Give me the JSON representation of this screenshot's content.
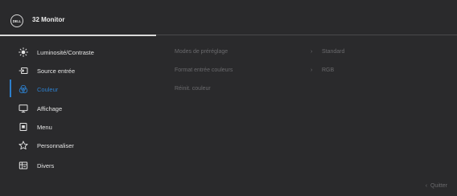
{
  "header": {
    "logo": "DELL",
    "title": "32 Monitor"
  },
  "sidebar": {
    "items": [
      {
        "label": "Luminosité/Contraste",
        "icon": "sun-icon"
      },
      {
        "label": "Source entrée",
        "icon": "input-source-icon"
      },
      {
        "label": "Couleur",
        "icon": "palette-icon",
        "selected": true
      },
      {
        "label": "Affichage",
        "icon": "display-icon"
      },
      {
        "label": "Menu",
        "icon": "menu-icon"
      },
      {
        "label": "Personnaliser",
        "icon": "star-icon"
      },
      {
        "label": "Divers",
        "icon": "misc-icon"
      }
    ]
  },
  "panel": {
    "rows": [
      {
        "label": "Modes de préréglage",
        "value": "Standard"
      },
      {
        "label": "Format entrée couleurs",
        "value": "RGB"
      },
      {
        "label": "Réinit. couleur",
        "value": ""
      }
    ]
  },
  "footer": {
    "exit_label": "Quitter"
  },
  "colors": {
    "accent": "#2d7fcc",
    "dim_text": "#6a6a6d",
    "background": "#2a2a2c"
  }
}
